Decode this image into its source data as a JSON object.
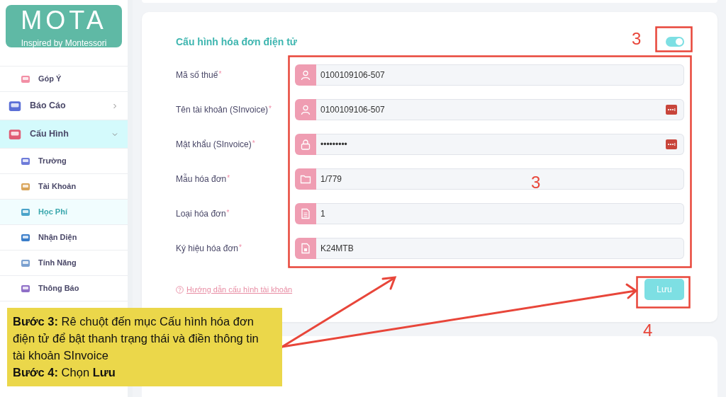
{
  "sidebar": {
    "logo": {
      "title": "MOTA",
      "subtitle": "Inspired by Montessori"
    },
    "items": [
      {
        "label": "Góp Ý",
        "kind": "sub",
        "selected": false
      },
      {
        "label": "Báo Cáo",
        "kind": "group",
        "expanded": false,
        "selected": false
      },
      {
        "label": "Cấu Hình",
        "kind": "group",
        "expanded": true,
        "selected": true,
        "children": [
          {
            "label": "Trường",
            "selected": false
          },
          {
            "label": "Tài Khoản",
            "selected": false
          },
          {
            "label": "Học Phí",
            "selected": true
          },
          {
            "label": "Nhận Diện",
            "selected": false
          },
          {
            "label": "Tính Năng",
            "selected": false
          },
          {
            "label": "Thông Báo",
            "selected": false
          }
        ]
      }
    ]
  },
  "form": {
    "title": "Cấu hình hóa đơn điện tử",
    "enabled": true,
    "fields": [
      {
        "label": "Mã số thuế",
        "required_mark": "*",
        "kind": "person",
        "value": "0100109106-507",
        "autofill": false
      },
      {
        "label": "Tên tài khoản (SInvoice)",
        "required_mark": "*",
        "kind": "person",
        "value": "0100109106-507",
        "autofill": true
      },
      {
        "label": "Mật khẩu (SInvoice)",
        "required_mark": "*",
        "kind": "lock",
        "value": "•••••••••",
        "autofill": true
      },
      {
        "label": "Mẫu hóa đơn",
        "required_mark": "*",
        "kind": "folder",
        "value": "1/779",
        "autofill": false
      },
      {
        "label": "Loại hóa đơn",
        "required_mark": "*",
        "kind": "page",
        "value": "1",
        "autofill": false
      },
      {
        "label": "Ký hiệu hóa đơn",
        "required_mark": "*",
        "kind": "file",
        "value": "K24MTB",
        "autofill": false
      }
    ],
    "help_link": "Hướng dẫn cấu hình tài khoản",
    "save_button": "Lưu"
  },
  "annotations": {
    "markers": [
      "3",
      "3",
      "4"
    ],
    "callout": [
      "**Bước 3:** Rê chuột đến mục Cấu hình hóa đơn điện tử để bật thanh trạng thái và điền thông tin tài khoản SInvoice",
      "**Bước 4:** Chọn **Lưu**"
    ]
  }
}
